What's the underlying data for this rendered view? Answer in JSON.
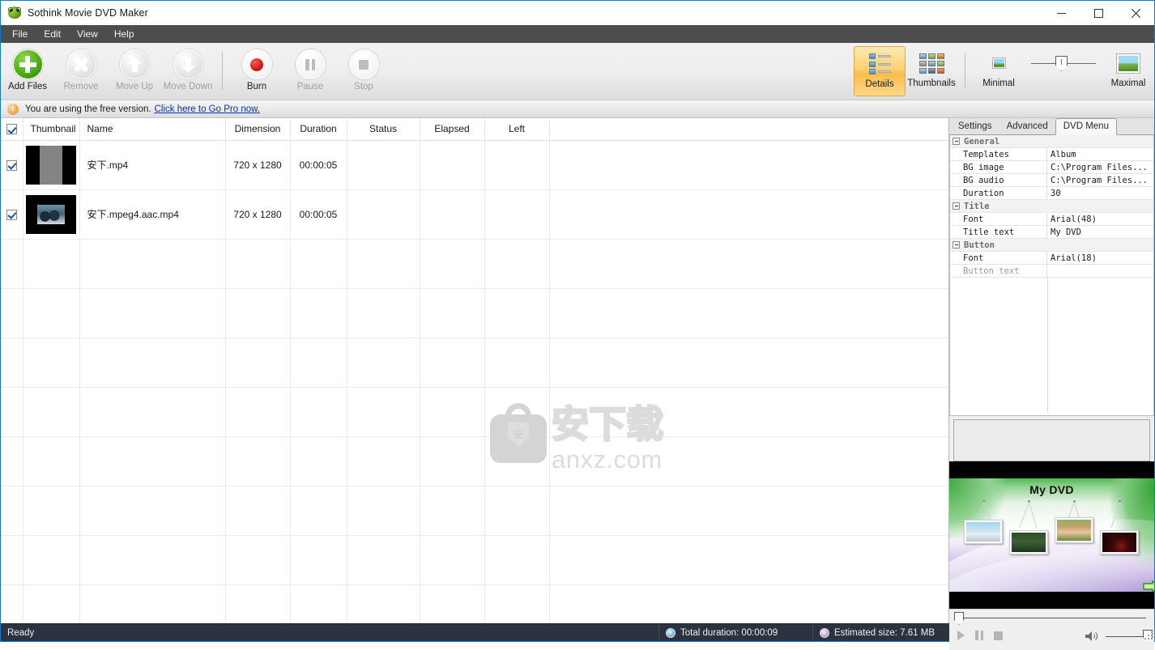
{
  "window": {
    "title": "Sothink Movie DVD Maker",
    "logo_icon": "frog-logo-icon",
    "minimize_label": "—",
    "maximize_label": "□",
    "close_label": "✕"
  },
  "menubar": {
    "items": [
      {
        "label": "File"
      },
      {
        "label": "Edit"
      },
      {
        "label": "View"
      },
      {
        "label": "Help"
      }
    ]
  },
  "toolbar": {
    "buttons": [
      {
        "label": "Add Files",
        "icon": "plus-circle-icon",
        "enabled": true
      },
      {
        "label": "Remove",
        "icon": "x-circle-icon",
        "enabled": false
      },
      {
        "label": "Move Up",
        "icon": "arrow-up-circle-icon",
        "enabled": false
      },
      {
        "label": "Move Down",
        "icon": "arrow-down-circle-icon",
        "enabled": false
      },
      {
        "label": "Burn",
        "icon": "record-circle-icon",
        "enabled": true
      },
      {
        "label": "Pause",
        "icon": "pause-circle-icon",
        "enabled": false
      },
      {
        "label": "Stop",
        "icon": "stop-circle-icon",
        "enabled": false
      }
    ],
    "views": [
      {
        "label": "Details",
        "icon": "details-view-icon",
        "active": true
      },
      {
        "label": "Thumbnails",
        "icon": "thumbnails-view-icon",
        "active": false
      }
    ],
    "zoom": {
      "min_label": "Minimal",
      "max_label": "Maximal",
      "min_icon": "small-image-icon",
      "max_icon": "large-image-icon",
      "value_percent": 42
    }
  },
  "notice": {
    "icon": "info-icon",
    "text": "You are using the free version.",
    "link": "Click here to Go Pro now."
  },
  "filelist": {
    "select_all_checked": true,
    "columns": [
      {
        "key": "check",
        "label": ""
      },
      {
        "key": "thumbnail",
        "label": "Thumbnail"
      },
      {
        "key": "name",
        "label": "Name"
      },
      {
        "key": "dimension",
        "label": "Dimension"
      },
      {
        "key": "duration",
        "label": "Duration"
      },
      {
        "key": "status",
        "label": "Status"
      },
      {
        "key": "elapsed",
        "label": "Elapsed"
      },
      {
        "key": "left",
        "label": "Left"
      }
    ],
    "rows": [
      {
        "checked": true,
        "thumb_style": "t1",
        "name": "安下.mp4",
        "dimension": "720 x 1280",
        "duration": "00:00:05",
        "status": "",
        "elapsed": "",
        "left": ""
      },
      {
        "checked": true,
        "thumb_style": "t2",
        "name": "安下.mpeg4.aac.mp4",
        "dimension": "720 x 1280",
        "duration": "00:00:05",
        "status": "",
        "elapsed": "",
        "left": ""
      }
    ],
    "empty_row_count": 8,
    "watermark": {
      "cn_text": "安下载",
      "domain": "anxz.com",
      "badge_char": "安"
    }
  },
  "right_panel": {
    "tabs": [
      {
        "label": "Settings",
        "active": false
      },
      {
        "label": "Advanced",
        "active": false
      },
      {
        "label": "DVD Menu",
        "active": true
      }
    ],
    "properties": [
      {
        "type": "category",
        "name": "General"
      },
      {
        "type": "prop",
        "name": "Templates",
        "value": "Album"
      },
      {
        "type": "prop",
        "name": "BG image",
        "value": "C:\\Program Files..."
      },
      {
        "type": "prop",
        "name": "BG audio",
        "value": "C:\\Program Files..."
      },
      {
        "type": "prop",
        "name": "Duration",
        "value": "30"
      },
      {
        "type": "category",
        "name": "Title"
      },
      {
        "type": "prop",
        "name": "Font",
        "value": "Arial(48)"
      },
      {
        "type": "prop",
        "name": "Title text",
        "value": "My DVD"
      },
      {
        "type": "category",
        "name": "Button"
      },
      {
        "type": "prop",
        "name": "Font",
        "value": "Arial(18)"
      },
      {
        "type": "prop",
        "name": "Button text",
        "value": "",
        "dim": true
      }
    ],
    "description": ""
  },
  "preview": {
    "menu_title": "My DVD",
    "template": "Album",
    "next_arrow_icon": "next-arrow-icon",
    "thumbnails": [
      {
        "name": "mountain-photo"
      },
      {
        "name": "forest-photo"
      },
      {
        "name": "portrait-photo"
      },
      {
        "name": "dark-photo"
      }
    ],
    "transport": {
      "play_icon": "play-icon",
      "pause_icon": "pause-icon",
      "stop_icon": "stop-icon",
      "volume_icon": "volume-icon",
      "seek_position_percent": 0,
      "volume_percent": 100
    }
  },
  "statusbar": {
    "status": "Ready",
    "total_duration_label": "Total duration: 00:00:09",
    "estimated_size_label": "Estimated size: 7.61 MB",
    "duration_icon": "disc-icon",
    "size_icon": "disc-icon"
  }
}
